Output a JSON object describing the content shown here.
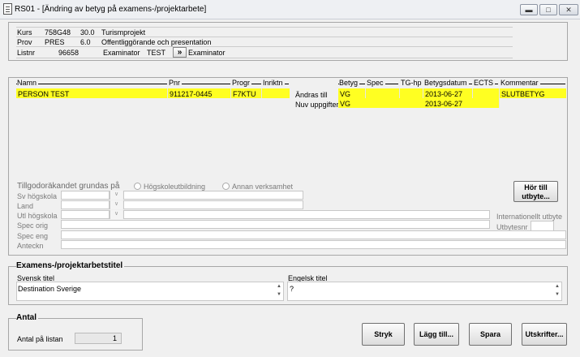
{
  "window": {
    "title": "RS01 - [Ändring av betyg på examens-/projektarbete]"
  },
  "info": {
    "kurs_label": "Kurs",
    "kurs_code": "758G48",
    "kurs_points": "30.0",
    "kurs_name": "Turismprojekt",
    "prov_label": "Prov",
    "prov_code": "PRES",
    "prov_points": "6.0",
    "prov_name": "Offentliggörande och presentation",
    "listnr_label": "Listnr",
    "listnr_value": "96658",
    "examinator_label": "Examinator",
    "examinator_value": "TEST",
    "examinator_button": "»",
    "examinator_button_label": "Examinator"
  },
  "grid": {
    "headers": {
      "namn": "Namn",
      "pnr": "Pnr",
      "progr": "Progr",
      "inriktn": "Inriktn",
      "betyg": "Betyg",
      "spec": "Spec",
      "tghp": "TG-hp",
      "betygsdatum": "Betygsdatum",
      "ects": "ECTS",
      "kommentar": "Kommentar"
    },
    "row": {
      "namn": "PERSON TEST",
      "pnr": "911217-0445",
      "progr": "F7KTU"
    },
    "andras_till": {
      "label": "Ändras till",
      "betyg": "VG",
      "datum": "2013-06-27",
      "kommentar": "SLUTBETYG"
    },
    "nuv_uppgifter": {
      "label": "Nuv uppgifter",
      "betyg": "VG",
      "datum": "2013-06-27"
    }
  },
  "tillgodo": {
    "label": "Tillgodoräkandet grundas på",
    "radio1": "Högskoleutbildning",
    "radio2": "Annan verksamhet",
    "sv_hogskola": "Sv högskola",
    "land": "Land",
    "utl_hogskola": "Utl högskola",
    "spec_orig": "Spec orig",
    "spec_eng": "Spec eng",
    "anteckn": "Anteckn",
    "hor_till_line1": "Hör till",
    "hor_till_line2": "utbyte...",
    "internationellt_utbyte": "Internationellt utbyte",
    "utbytesnr": "Utbytesnr"
  },
  "titel": {
    "group": "Examens-/projektarbetstitel",
    "svensk_label": "Svensk titel",
    "svensk_value": "Destination Sverige",
    "engelsk_label": "Engelsk titel",
    "engelsk_value": "?"
  },
  "antal": {
    "group": "Antal",
    "label": "Antal på listan",
    "value": "1"
  },
  "buttons": {
    "stryk": "Stryk",
    "lagg_till": "Lägg till...",
    "spara": "Spara",
    "utskrifter": "Utskrifter..."
  }
}
